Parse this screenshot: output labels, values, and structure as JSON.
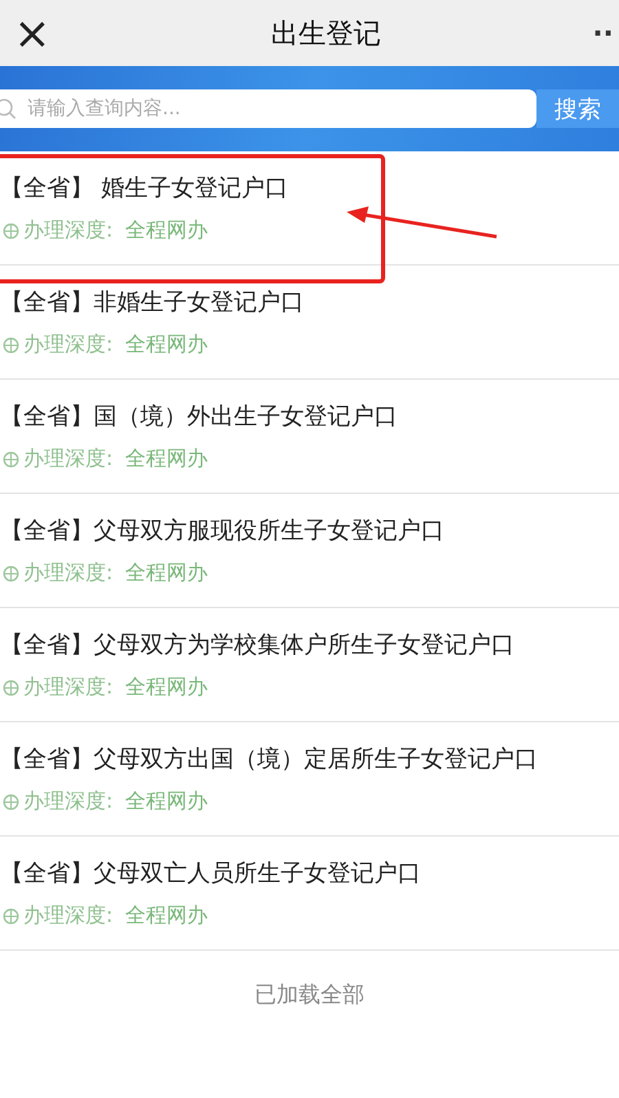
{
  "nav": {
    "close": "×",
    "title": "出生登记",
    "more": "··"
  },
  "search": {
    "placeholder": "请输入查询内容...",
    "button": "搜索"
  },
  "items": [
    {
      "title": "【全省】 婚生子女登记户口",
      "depth_label": "办理深度:",
      "depth_value": "全程网办",
      "highlighted": true
    },
    {
      "title": "【全省】非婚生子女登记户口",
      "depth_label": "办理深度:",
      "depth_value": "全程网办",
      "highlighted": false
    },
    {
      "title": "【全省】国（境）外出生子女登记户口",
      "depth_label": "办理深度:",
      "depth_value": "全程网办",
      "highlighted": false
    },
    {
      "title": "【全省】父母双方服现役所生子女登记户口",
      "depth_label": "办理深度:",
      "depth_value": "全程网办",
      "highlighted": false
    },
    {
      "title": "【全省】父母双方为学校集体户所生子女登记户口",
      "depth_label": "办理深度:",
      "depth_value": "全程网办",
      "highlighted": false
    },
    {
      "title": "【全省】父母双方出国（境）定居所生子女登记户口",
      "depth_label": "办理深度:",
      "depth_value": "全程网办",
      "highlighted": false
    },
    {
      "title": "【全省】父母双亡人员所生子女登记户口",
      "depth_label": "办理深度:",
      "depth_value": "全程网办",
      "highlighted": false
    }
  ],
  "footer": "已加载全部"
}
